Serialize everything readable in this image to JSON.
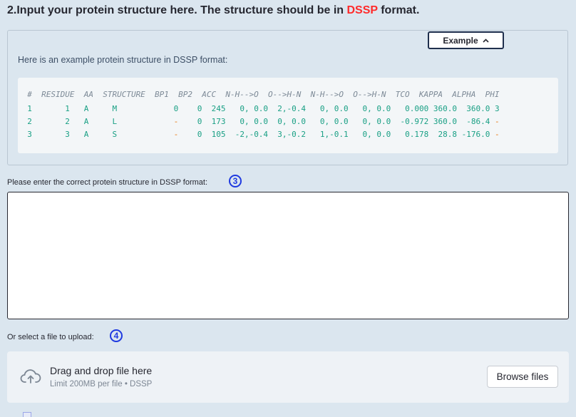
{
  "section": {
    "title_prefix": "2.Input your protein structure here. The structure should be in ",
    "title_highlight": "DSSP",
    "title_suffix": " format."
  },
  "example": {
    "button_label": "Example",
    "button_icon": "chevron-up-icon",
    "description": "Here is an example protein structure in DSSP format:",
    "code_header": "  #  RESIDUE  AA  STRUCTURE  BP1  BP2  ACC  N-H-->O  O-->H-N  N-H-->O  O-->H-N  TCO  KAPPA  ALPHA  PHI",
    "rows": [
      [
        "  1",
        "       1",
        "   A",
        "     M",
        "            0",
        "    0",
        "  245",
        "   0, 0.0",
        "  2,-0.4",
        "   0, 0.0",
        "   0, 0.0",
        "   0.000",
        " 360.0",
        "  360.0",
        " 3"
      ],
      [
        "  2",
        "       2",
        "   A",
        "     L",
        "            -",
        "    0",
        "  173",
        "   0, 0.0",
        "  0, 0.0",
        "   0, 0.0",
        "   0, 0.0",
        "  -0.972",
        " 360.0",
        "  -86.4",
        " -"
      ],
      [
        "  3",
        "       3",
        "   A",
        "     S",
        "            -",
        "    0",
        "  105",
        "  -2,-0.4",
        "  3,-0.2",
        "   1,-0.1",
        "   0, 0.0",
        "   0.178",
        "  28.8",
        " -176.0",
        " -"
      ]
    ]
  },
  "structure_input": {
    "label": "Please enter the correct protein structure in DSSP format:",
    "step_number": "3",
    "value": ""
  },
  "file_upload": {
    "label": "Or select a file to upload:",
    "step_number": "4",
    "drop_title": "Drag and drop file here",
    "drop_subtitle": "Limit 200MB per file • DSSP",
    "browse_label": "Browse files",
    "icon": "cloud-upload-icon"
  },
  "colors": {
    "background": "#dbe6ef",
    "accent_red": "#ff2b2b",
    "badge_blue": "#1f3ae0",
    "code_green": "#1aa085",
    "code_orange": "#e8760e"
  }
}
